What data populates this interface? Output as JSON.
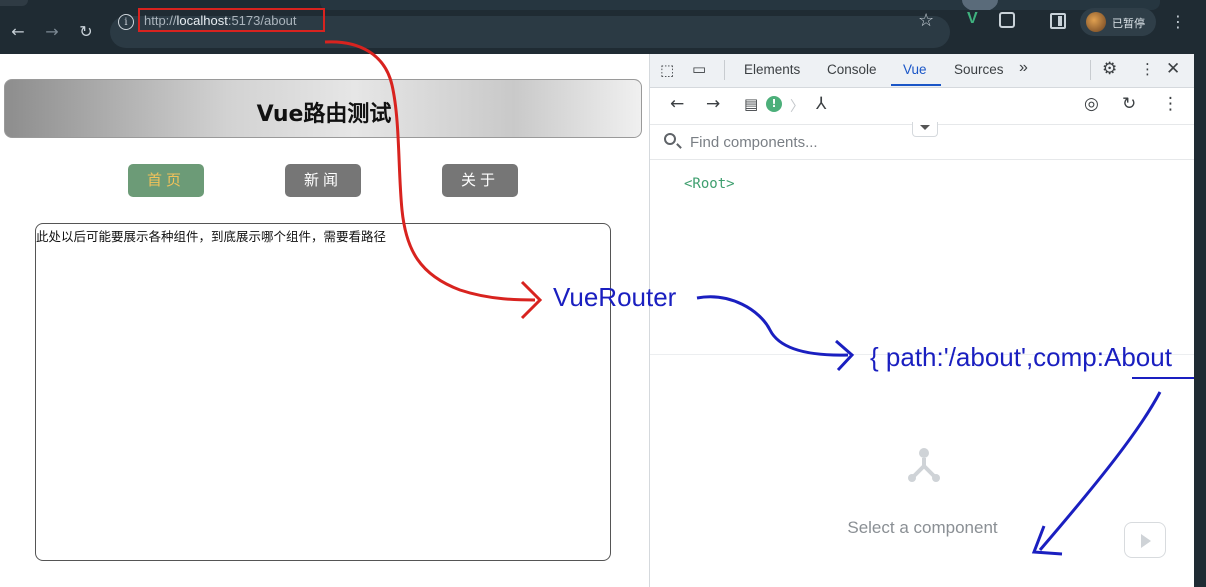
{
  "browser": {
    "url_prefix": "http://",
    "url_host": "localhost",
    "url_rest": ":5173/about",
    "profile_label": "已暂停",
    "icons": [
      "back-icon",
      "forward-icon",
      "reload-icon",
      "info-icon",
      "star-icon",
      "vue-extension-icon",
      "extensions-puzzle-icon",
      "side-panel-icon",
      "kebab-menu-icon"
    ]
  },
  "page": {
    "title": "Vue路由测试",
    "nav": [
      {
        "label": "首页",
        "active": true
      },
      {
        "label": "新闻",
        "active": false
      },
      {
        "label": "关于",
        "active": false
      }
    ],
    "content_text": "此处以后可能要展示各种组件，到底展示哪个组件，需要看路径"
  },
  "devtools": {
    "tabs": [
      "Elements",
      "Console",
      "Vue",
      "Sources"
    ],
    "active_tab": "Vue",
    "more_tabs": "»",
    "find_placeholder": "Find components...",
    "root_node": "<Root>",
    "empty_state": "Select a component",
    "warning_badge": "!"
  },
  "annotations": {
    "router_label": "VueRouter",
    "route_label": "{ path:'/about',comp:About",
    "colors": {
      "red": "#d8231f",
      "blue": "#1a1fc0"
    }
  }
}
